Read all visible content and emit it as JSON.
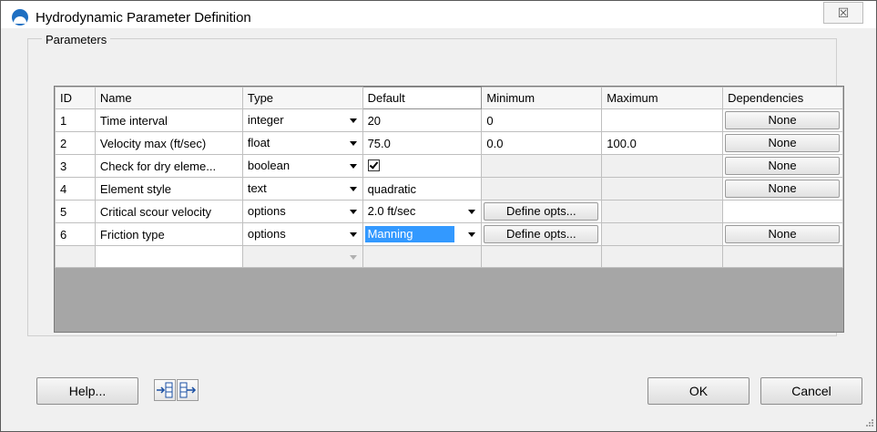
{
  "window": {
    "title": "Hydrodynamic Parameter Definition",
    "close_glyph": "☒"
  },
  "group": {
    "label": "Parameters"
  },
  "columns": [
    "ID",
    "Name",
    "Type",
    "Default",
    "Minimum",
    "Maximum",
    "Dependencies"
  ],
  "rows": [
    {
      "id": "1",
      "name": "Time interval",
      "type": "integer",
      "default": "20",
      "minimum": "0",
      "maximum": "",
      "dependencies": "None"
    },
    {
      "id": "2",
      "name": "Velocity max (ft/sec)",
      "type": "float",
      "default": "75.0",
      "minimum": "0.0",
      "maximum": "100.0",
      "dependencies": "None"
    },
    {
      "id": "3",
      "name": "Check for dry eleme...",
      "type": "boolean",
      "default_checked": true,
      "dependencies": "None"
    },
    {
      "id": "4",
      "name": "Element style",
      "type": "text",
      "default": "quadratic",
      "dependencies": "None"
    },
    {
      "id": "5",
      "name": "Critical scour velocity",
      "type": "options",
      "default": "2.0 ft/sec",
      "minimum_button": "Define opts..."
    },
    {
      "id": "6",
      "name": "Friction type",
      "type": "options",
      "default": "Manning",
      "minimum_button": "Define opts...",
      "dependencies": "None"
    }
  ],
  "buttons": {
    "help": "Help...",
    "ok": "OK",
    "cancel": "Cancel"
  },
  "icons": {
    "insert_row": "insert-row-icon",
    "append_row": "append-row-icon"
  },
  "colors": {
    "selection": "#3399ff",
    "grid_background": "#a6a6a6",
    "app_icon": "#1e6fc2"
  }
}
